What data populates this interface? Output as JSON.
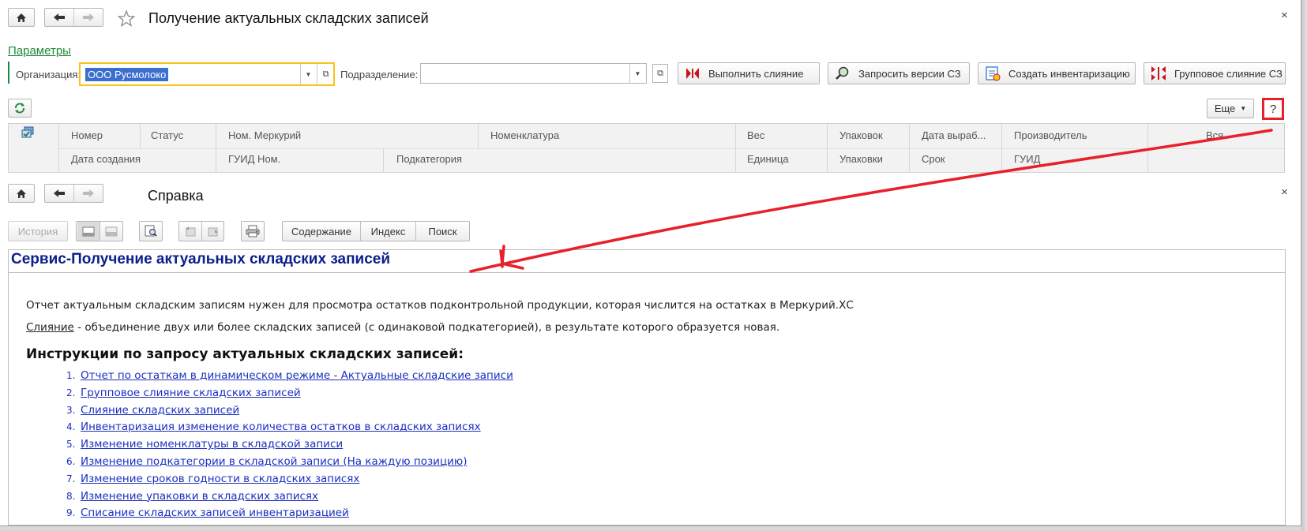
{
  "main_window": {
    "title": "Получение актуальных складских записей",
    "params_link": "Параметры",
    "org_label": "Организация:",
    "org_value": "ООО Русмолоко",
    "subdivision_label": "Подразделение:",
    "subdivision_value": "",
    "buttons": {
      "merge": "Выполнить слияние",
      "request_versions": "Запросить версии СЗ",
      "create_inventory": "Создать инвентаризацию",
      "group_merge": "Групповое слияние СЗ",
      "more": "Еще",
      "help": "?"
    },
    "grid": {
      "row1": [
        "Номер",
        "Статус",
        "Ном. Меркурий",
        "Номенклатура",
        "Вес",
        "Упаковок",
        "Дата выраб...",
        "Производитель",
        "Вся"
      ],
      "row2": [
        "Дата создания",
        "ГУИД Ном.",
        "Подкатегория",
        "Единица",
        "Упаковки",
        "Срок",
        "ГУИД"
      ]
    }
  },
  "help_window": {
    "title": "Справка",
    "toolbar": {
      "history": "История",
      "contents": "Содержание",
      "index": "Индекс",
      "search": "Поиск"
    },
    "heading": "Сервис-Получение актуальных складских записей",
    "paragraph1": "Отчет актуальным складским записям нужен для просмотра остатков подконтрольной продукции, которая числится на остатках в Меркурий.ХС",
    "merge_term": "Слияние",
    "paragraph2_rest": " - объединение двух или более складских записей (с одинаковой подкатегорией), в результате которого образуется новая.",
    "instructions_heading": "Инструкции по запросу актуальных складских записей:",
    "links": [
      {
        "num": "1.",
        "text": "Отчет по остаткам в динамическом режиме - Актуальные складские записи"
      },
      {
        "num": "2.",
        "text": "Групповое слияние складских записей"
      },
      {
        "num": "3.",
        "text": "Слияние складских записей"
      },
      {
        "num": "4.",
        "text": "Инвентаризация изменение количества остатков в складских записях"
      },
      {
        "num": "5.",
        "text": "Изменение номенклатуры в складской записи"
      },
      {
        "num": "6.",
        "text": "Изменение подкатегории в складской записи (На каждую позицию)"
      },
      {
        "num": "7.",
        "text": "Изменение сроков годности в складских записях"
      },
      {
        "num": "8.",
        "text": "Изменение упаковки в складских записях"
      },
      {
        "num": "9.",
        "text": "Списание складских записей инвентаризацией"
      }
    ]
  },
  "colors": {
    "heading_blue": "#0b1e8a",
    "link_blue": "#1a2fbf",
    "params_green": "#1f8a3a",
    "highlight_yellow": "#f5c518",
    "annotation_red": "#e8202a"
  }
}
